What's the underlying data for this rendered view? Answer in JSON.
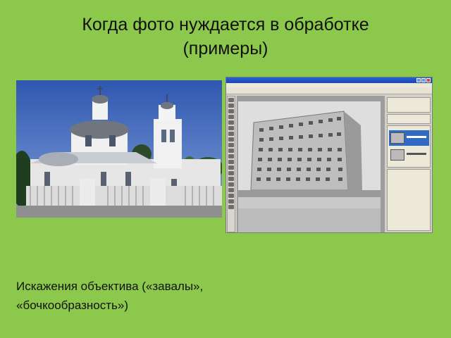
{
  "slide": {
    "title_line1": "Когда фото нуждается в обработке",
    "title_line2": "(примеры)",
    "caption_line1": "Искажения объектива («завалы»,",
    "caption_line2": "«бочкообразность»)"
  },
  "images": {
    "church_photo": "church-photo",
    "photoshop_screenshot": "photoshop-screenshot"
  },
  "colors": {
    "background": "#8cc84b",
    "sky": "#3b63b8",
    "photoshop_selection": "#316ac5"
  }
}
